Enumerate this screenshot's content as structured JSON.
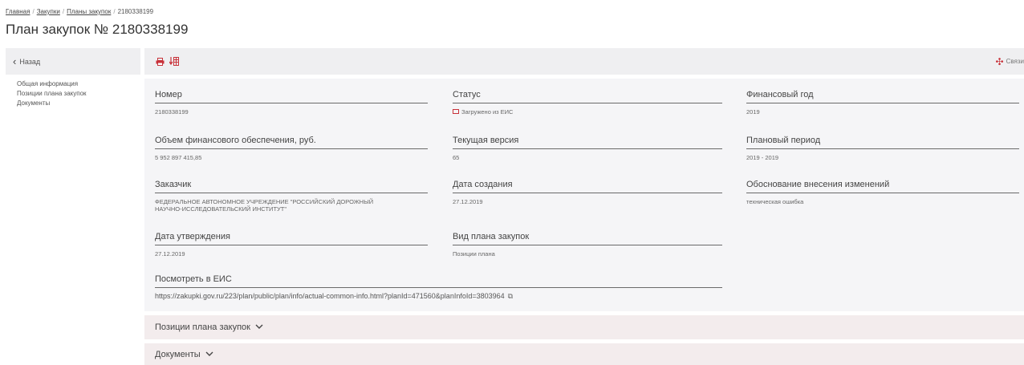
{
  "breadcrumb": {
    "items": [
      "Главная",
      "Закупки",
      "Планы закупок"
    ],
    "current": "2180338199"
  },
  "page_title": "План закупок № 2180338199",
  "back_label": "Назад",
  "nav": [
    "Общая информация",
    "Позиции плана закупок",
    "Документы"
  ],
  "toolbar": {
    "print_icon": "printer-icon",
    "export_icon": "export-icon",
    "links_label": "Связи",
    "links_icon": "links-icon"
  },
  "fields": {
    "number": {
      "label": "Номер",
      "value": "2180338199"
    },
    "status": {
      "label": "Статус",
      "value": "Загружено из ЕИС"
    },
    "fin_year": {
      "label": "Финансовый год",
      "value": "2019"
    },
    "fin_volume": {
      "label": "Объем финансового обеспечения, руб.",
      "value": "5 952 897 415,85"
    },
    "version": {
      "label": "Текущая версия",
      "value": "65"
    },
    "plan_period": {
      "label": "Плановый период",
      "value": "2019 - 2019"
    },
    "customer": {
      "label": "Заказчик",
      "value": "ФЕДЕРАЛЬНОЕ АВТОНОМНОЕ УЧРЕЖДЕНИЕ \"РОССИЙСКИЙ ДОРОЖНЫЙ НАУЧНО-ИССЛЕДОВАТЕЛЬСКИЙ ИНСТИТУТ\""
    },
    "created": {
      "label": "Дата создания",
      "value": "27.12.2019"
    },
    "change_reason": {
      "label": "Обоснование внесения изменений",
      "value": "техническая ошибка"
    },
    "approved": {
      "label": "Дата утверждения",
      "value": "27.12.2019"
    },
    "plan_type": {
      "label": "Вид плана закупок",
      "value": "Позиции плана"
    },
    "eis_link": {
      "label": "Посмотреть в ЕИС",
      "value": "https://zakupki.gov.ru/223/plan/public/plan/info/actual-common-info.html?planId=471560&planInfoId=3803964"
    }
  },
  "sections": {
    "positions": "Позиции плана закупок",
    "documents": "Документы"
  },
  "colors": {
    "accent": "#c8323a",
    "panel": "#f5f5f7",
    "section": "#f3eced"
  }
}
